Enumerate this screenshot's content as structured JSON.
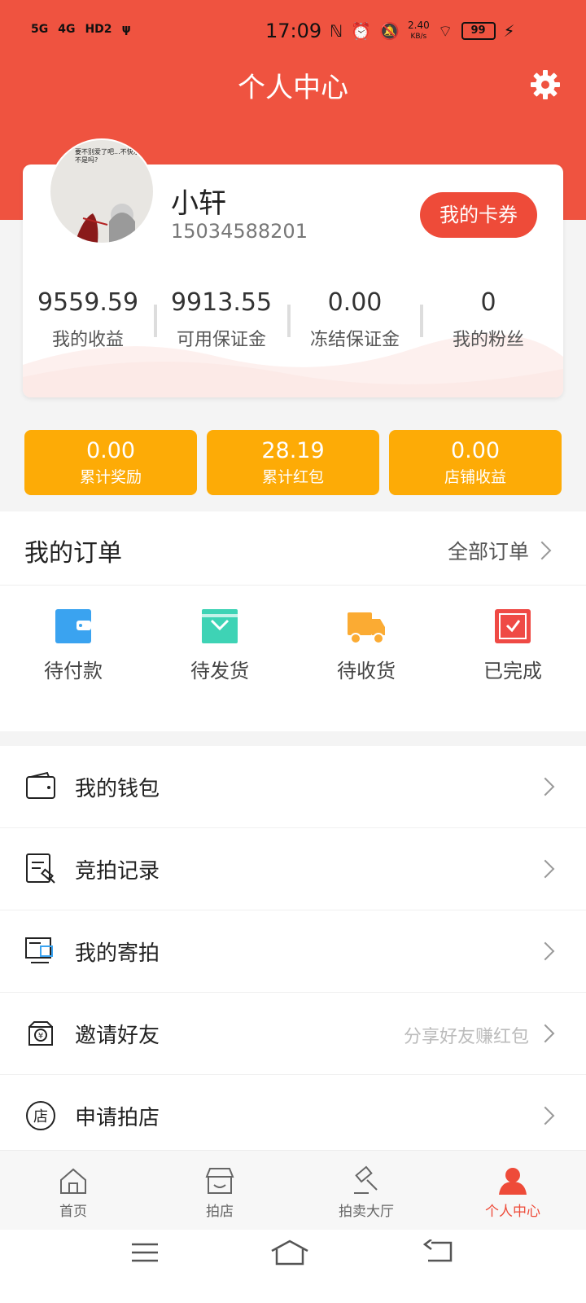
{
  "status_bar": {
    "signals": [
      "5G",
      "4G",
      "HD2"
    ],
    "time": "17:09",
    "speed_value": "2.40",
    "speed_unit": "KB/s",
    "battery": "99"
  },
  "header": {
    "title": "个人中心"
  },
  "profile": {
    "avatar_text": "要不别爱了吧...不快乐不是吗?",
    "name": "小轩",
    "phone": "15034588201",
    "coupon_label": "我的卡券"
  },
  "stats": [
    {
      "value": "9559.59",
      "label": "我的收益"
    },
    {
      "value": "9913.55",
      "label": "可用保证金"
    },
    {
      "value": "0.00",
      "label": "冻结保证金"
    },
    {
      "value": "0",
      "label": "我的粉丝"
    }
  ],
  "rewards": [
    {
      "value": "0.00",
      "label": "累计奖励"
    },
    {
      "value": "28.19",
      "label": "累计红包"
    },
    {
      "value": "0.00",
      "label": "店铺收益"
    }
  ],
  "orders": {
    "title": "我的订单",
    "all_label": "全部订单",
    "items": [
      {
        "label": "待付款",
        "icon": "wallet-icon",
        "color": "#3aa3f0"
      },
      {
        "label": "待发货",
        "icon": "box-icon",
        "color": "#3ed3b5"
      },
      {
        "label": "待收货",
        "icon": "truck-icon",
        "color": "#fbab33"
      },
      {
        "label": "已完成",
        "icon": "completed-icon",
        "color": "#ef4a45"
      }
    ]
  },
  "menu": [
    {
      "label": "我的钱包",
      "hint": "",
      "icon": "wallet-outline-icon"
    },
    {
      "label": "竞拍记录",
      "hint": "",
      "icon": "auction-record-icon"
    },
    {
      "label": "我的寄拍",
      "hint": "",
      "icon": "consign-icon"
    },
    {
      "label": "邀请好友",
      "hint": "分享好友赚红包",
      "icon": "invite-icon"
    },
    {
      "label": "申请拍店",
      "hint": "",
      "icon": "shop-apply-icon"
    }
  ],
  "bottom_nav": [
    {
      "label": "首页",
      "icon": "home-icon",
      "active": false
    },
    {
      "label": "拍店",
      "icon": "store-icon",
      "active": false
    },
    {
      "label": "拍卖大厅",
      "icon": "auction-hall-icon",
      "active": false
    },
    {
      "label": "个人中心",
      "icon": "user-icon",
      "active": true
    }
  ],
  "colors": {
    "header": "#ef5340",
    "accent": "#ee4b39",
    "reward": "#fdab06"
  }
}
